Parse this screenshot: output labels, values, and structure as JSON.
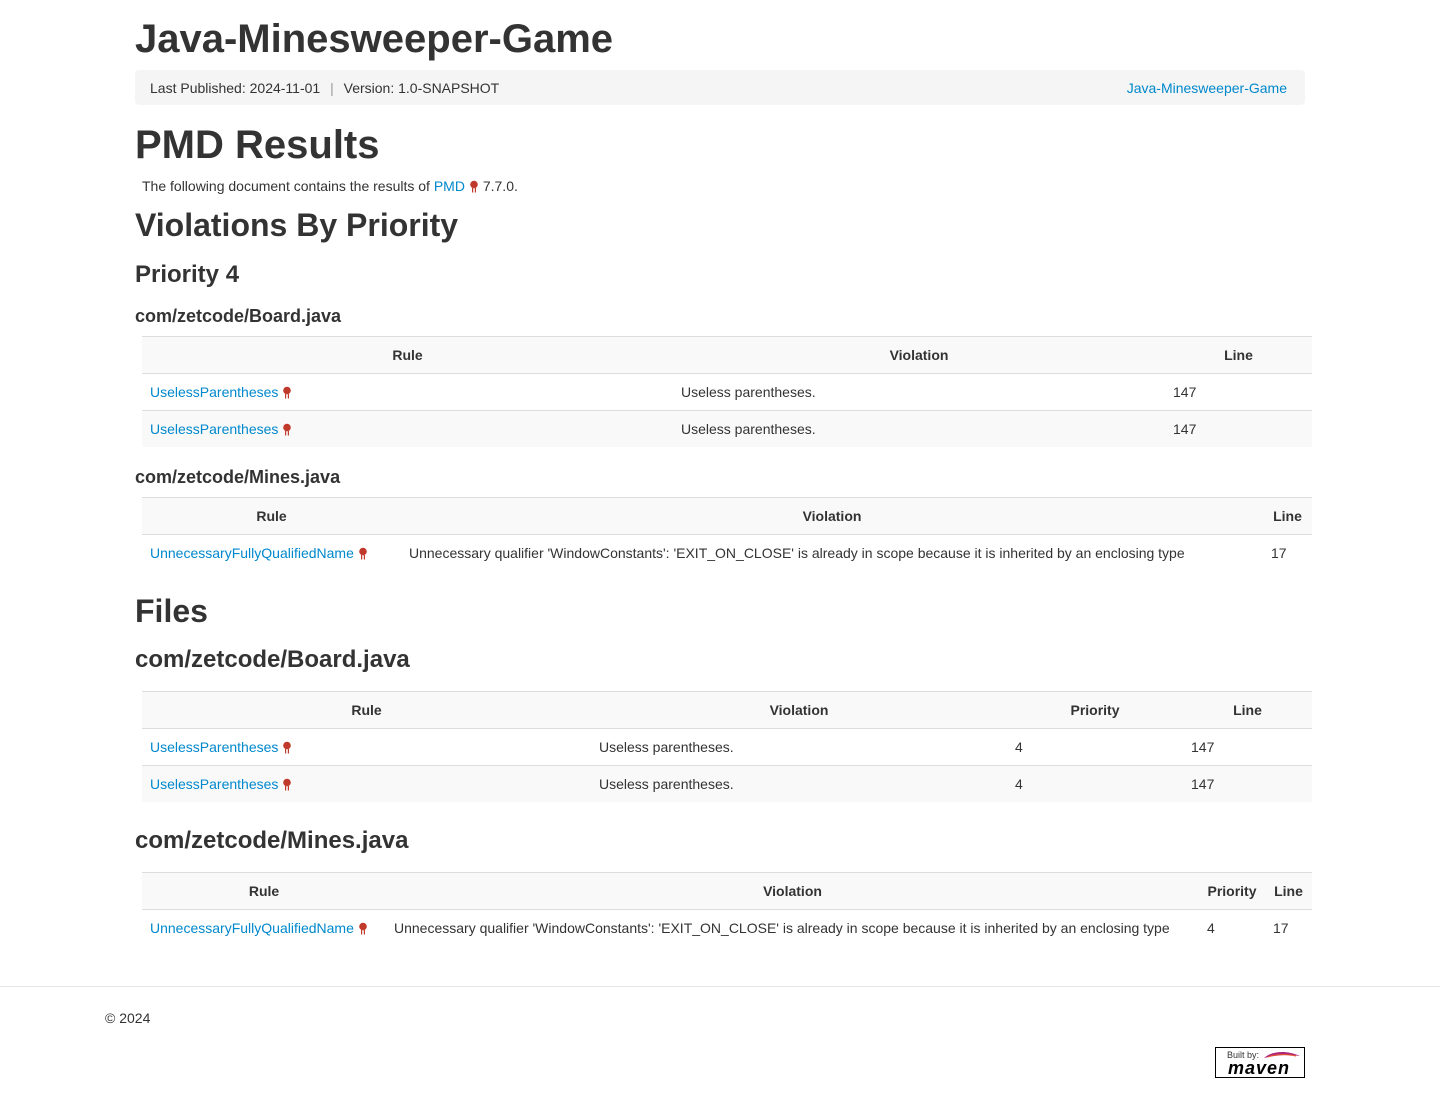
{
  "site": {
    "title": "Java-Minesweeper-Game",
    "last_published": "Last Published: 2024-11-01",
    "separator": "|",
    "version": "Version: 1.0-SNAPSHOT",
    "project_link": "Java-Minesweeper-Game"
  },
  "report": {
    "title": "PMD Results",
    "intro_prefix": "The following document contains the results of",
    "pmd_link": "PMD",
    "pmd_version": "7.7.0."
  },
  "by_priority": {
    "title": "Violations By Priority",
    "priority_title": "Priority 4",
    "files": [
      {
        "name": "com/zetcode/Board.java",
        "headers": [
          "Rule",
          "Violation",
          "Line"
        ],
        "rows": [
          {
            "rule": "UselessParentheses",
            "violation": "Useless parentheses.",
            "line": "147"
          },
          {
            "rule": "UselessParentheses",
            "violation": "Useless parentheses.",
            "line": "147"
          }
        ]
      },
      {
        "name": "com/zetcode/Mines.java",
        "headers": [
          "Rule",
          "Violation",
          "Line"
        ],
        "rows": [
          {
            "rule": "UnnecessaryFullyQualifiedName",
            "violation": "Unnecessary qualifier 'WindowConstants': 'EXIT_ON_CLOSE' is already in scope because it is inherited by an enclosing type",
            "line": "17"
          }
        ]
      }
    ]
  },
  "files_section": {
    "title": "Files",
    "files": [
      {
        "name": "com/zetcode/Board.java",
        "headers": [
          "Rule",
          "Violation",
          "Priority",
          "Line"
        ],
        "rows": [
          {
            "rule": "UselessParentheses",
            "violation": "Useless parentheses.",
            "priority": "4",
            "line": "147"
          },
          {
            "rule": "UselessParentheses",
            "violation": "Useless parentheses.",
            "priority": "4",
            "line": "147"
          }
        ]
      },
      {
        "name": "com/zetcode/Mines.java",
        "headers": [
          "Rule",
          "Violation",
          "Priority",
          "Line"
        ],
        "rows": [
          {
            "rule": "UnnecessaryFullyQualifiedName",
            "violation": "Unnecessary qualifier 'WindowConstants': 'EXIT_ON_CLOSE' is already in scope because it is inherited by an enclosing type",
            "priority": "4",
            "line": "17"
          }
        ]
      }
    ]
  },
  "footer": {
    "copyright": "© 2024",
    "badge_built": "Built by:",
    "badge_word": "maven"
  },
  "colors": {
    "link": "#0088cc",
    "header_bg": "#f9f9f9",
    "breadcrumb_bg": "#f5f5f5",
    "text": "#333333",
    "external_icon": "#c0392b"
  },
  "icons": {
    "external": "external-link-icon",
    "maven_feather": "maven-feather-icon"
  }
}
